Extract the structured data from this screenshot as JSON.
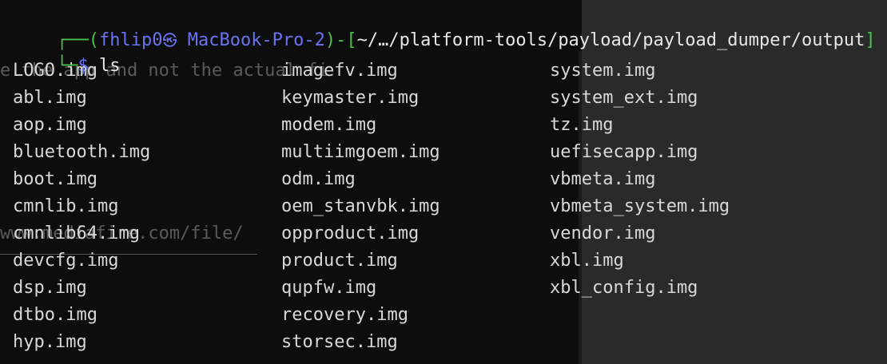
{
  "prompt": {
    "corner_top": "┌──",
    "open_paren": "(",
    "user": "fhlip0",
    "host_icon": "skull-icon",
    "host_glyph": "㉿",
    "host": "MacBook-Pro-2",
    "close_paren": ")",
    "dash": "-",
    "open_bracket": "[",
    "path": "~/…/platform-tools/payload/payload_dumper/output",
    "close_bracket": "]",
    "corner_bottom": "└─",
    "symbol": "$",
    "command": "ls"
  },
  "ghost": {
    "line1": "e the app and not the actual fi",
    "line2": "www.mediafire.com/file/"
  },
  "files": [
    "LOGO.img",
    "abl.img",
    "aop.img",
    "bluetooth.img",
    "boot.img",
    "cmnlib.img",
    "cmnlib64.img",
    "devcfg.img",
    "dsp.img",
    "dtbo.img",
    "hyp.img",
    "imagefv.img",
    "keymaster.img",
    "modem.img",
    "multiimgoem.img",
    "odm.img",
    "oem_stanvbk.img",
    "opproduct.img",
    "product.img",
    "qupfw.img",
    "recovery.img",
    "storsec.img",
    "system.img",
    "system_ext.img",
    "tz.img",
    "uefisecapp.img",
    "vbmeta.img",
    "vbmeta_system.img",
    "vendor.img",
    "xbl.img",
    "xbl_config.img"
  ],
  "colors": {
    "background": "#0d0d0d",
    "prompt_frame": "#4cc04c",
    "prompt_user": "#6a74f0",
    "text": "#d8d8d8",
    "ghost_text": "#5a5a5a",
    "background_pane": "#2a2a2a"
  }
}
